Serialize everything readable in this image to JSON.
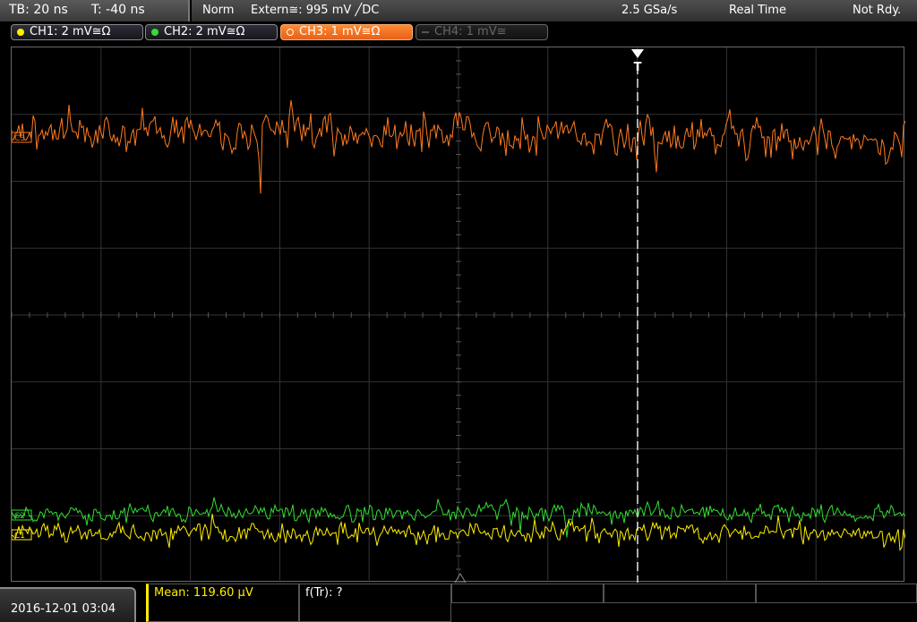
{
  "status": {
    "timebase": "TB: 20 ns",
    "trigger_time": "T: -40 ns",
    "mode": "Norm",
    "trigger_source": "Extern≅: 995 mV ╱DC",
    "sample_rate": "2.5 GSa/s",
    "acq_mode": "Real Time",
    "state": "Not Rdy."
  },
  "channels": [
    {
      "label": "CH1: 2 mV≅Ω",
      "color": "#ffee00",
      "active": false
    },
    {
      "label": "CH2: 2 mV≅Ω",
      "color": "#33dd33",
      "active": false
    },
    {
      "label": "CH3: 1 mV≅Ω",
      "color": "#ff7a20",
      "active": true
    },
    {
      "label": "CH4: 1 mV≅",
      "color": "#555555",
      "active": false
    }
  ],
  "screen": {
    "trigger_marker": "T",
    "ch3_marker": "C3",
    "ch2_marker": "C2",
    "ch1_marker": "C1"
  },
  "footer": {
    "datetime": "2016-12-01 03:04",
    "mean": "Mean: 119.60 µV",
    "ftr": "f(Tr): ?"
  },
  "colors": {
    "ch1": "#ffee00",
    "ch2": "#33dd33",
    "ch3": "#ff7a20",
    "grid": "#3a3a3a",
    "trigger": "#ffffff"
  }
}
